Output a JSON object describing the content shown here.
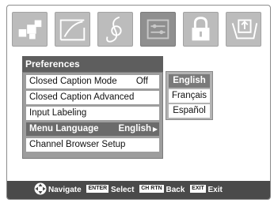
{
  "tabs": [
    {
      "icon": "picture-icon"
    },
    {
      "icon": "audio-icon"
    },
    {
      "icon": "music-icon"
    },
    {
      "icon": "preferences-icon",
      "active": true
    },
    {
      "icon": "lock-icon"
    },
    {
      "icon": "setup-icon"
    }
  ],
  "menu": {
    "title": "Preferences",
    "items": [
      {
        "label": "Closed Caption Mode",
        "value": "Off"
      },
      {
        "label": "Closed Caption Advanced",
        "value": ""
      },
      {
        "label": "Input Labeling",
        "value": ""
      },
      {
        "label": "Menu Language",
        "value": "English",
        "selected": true
      },
      {
        "label": "Channel Browser Setup",
        "value": ""
      }
    ]
  },
  "language_options": [
    {
      "label": "English",
      "selected": true
    },
    {
      "label": "Français"
    },
    {
      "label": "Español"
    }
  ],
  "footer": {
    "navigate": "Navigate",
    "enter_key": "ENTER",
    "select": "Select",
    "chrtn_key": "CH RTN",
    "back": "Back",
    "exit_key": "EXIT",
    "exit": "Exit"
  },
  "colors": {
    "panel_header": "#5e5e5e",
    "selected_row": "#6b6b6b",
    "footer": "#4a4a4a",
    "tab": "#bcbcbc"
  }
}
